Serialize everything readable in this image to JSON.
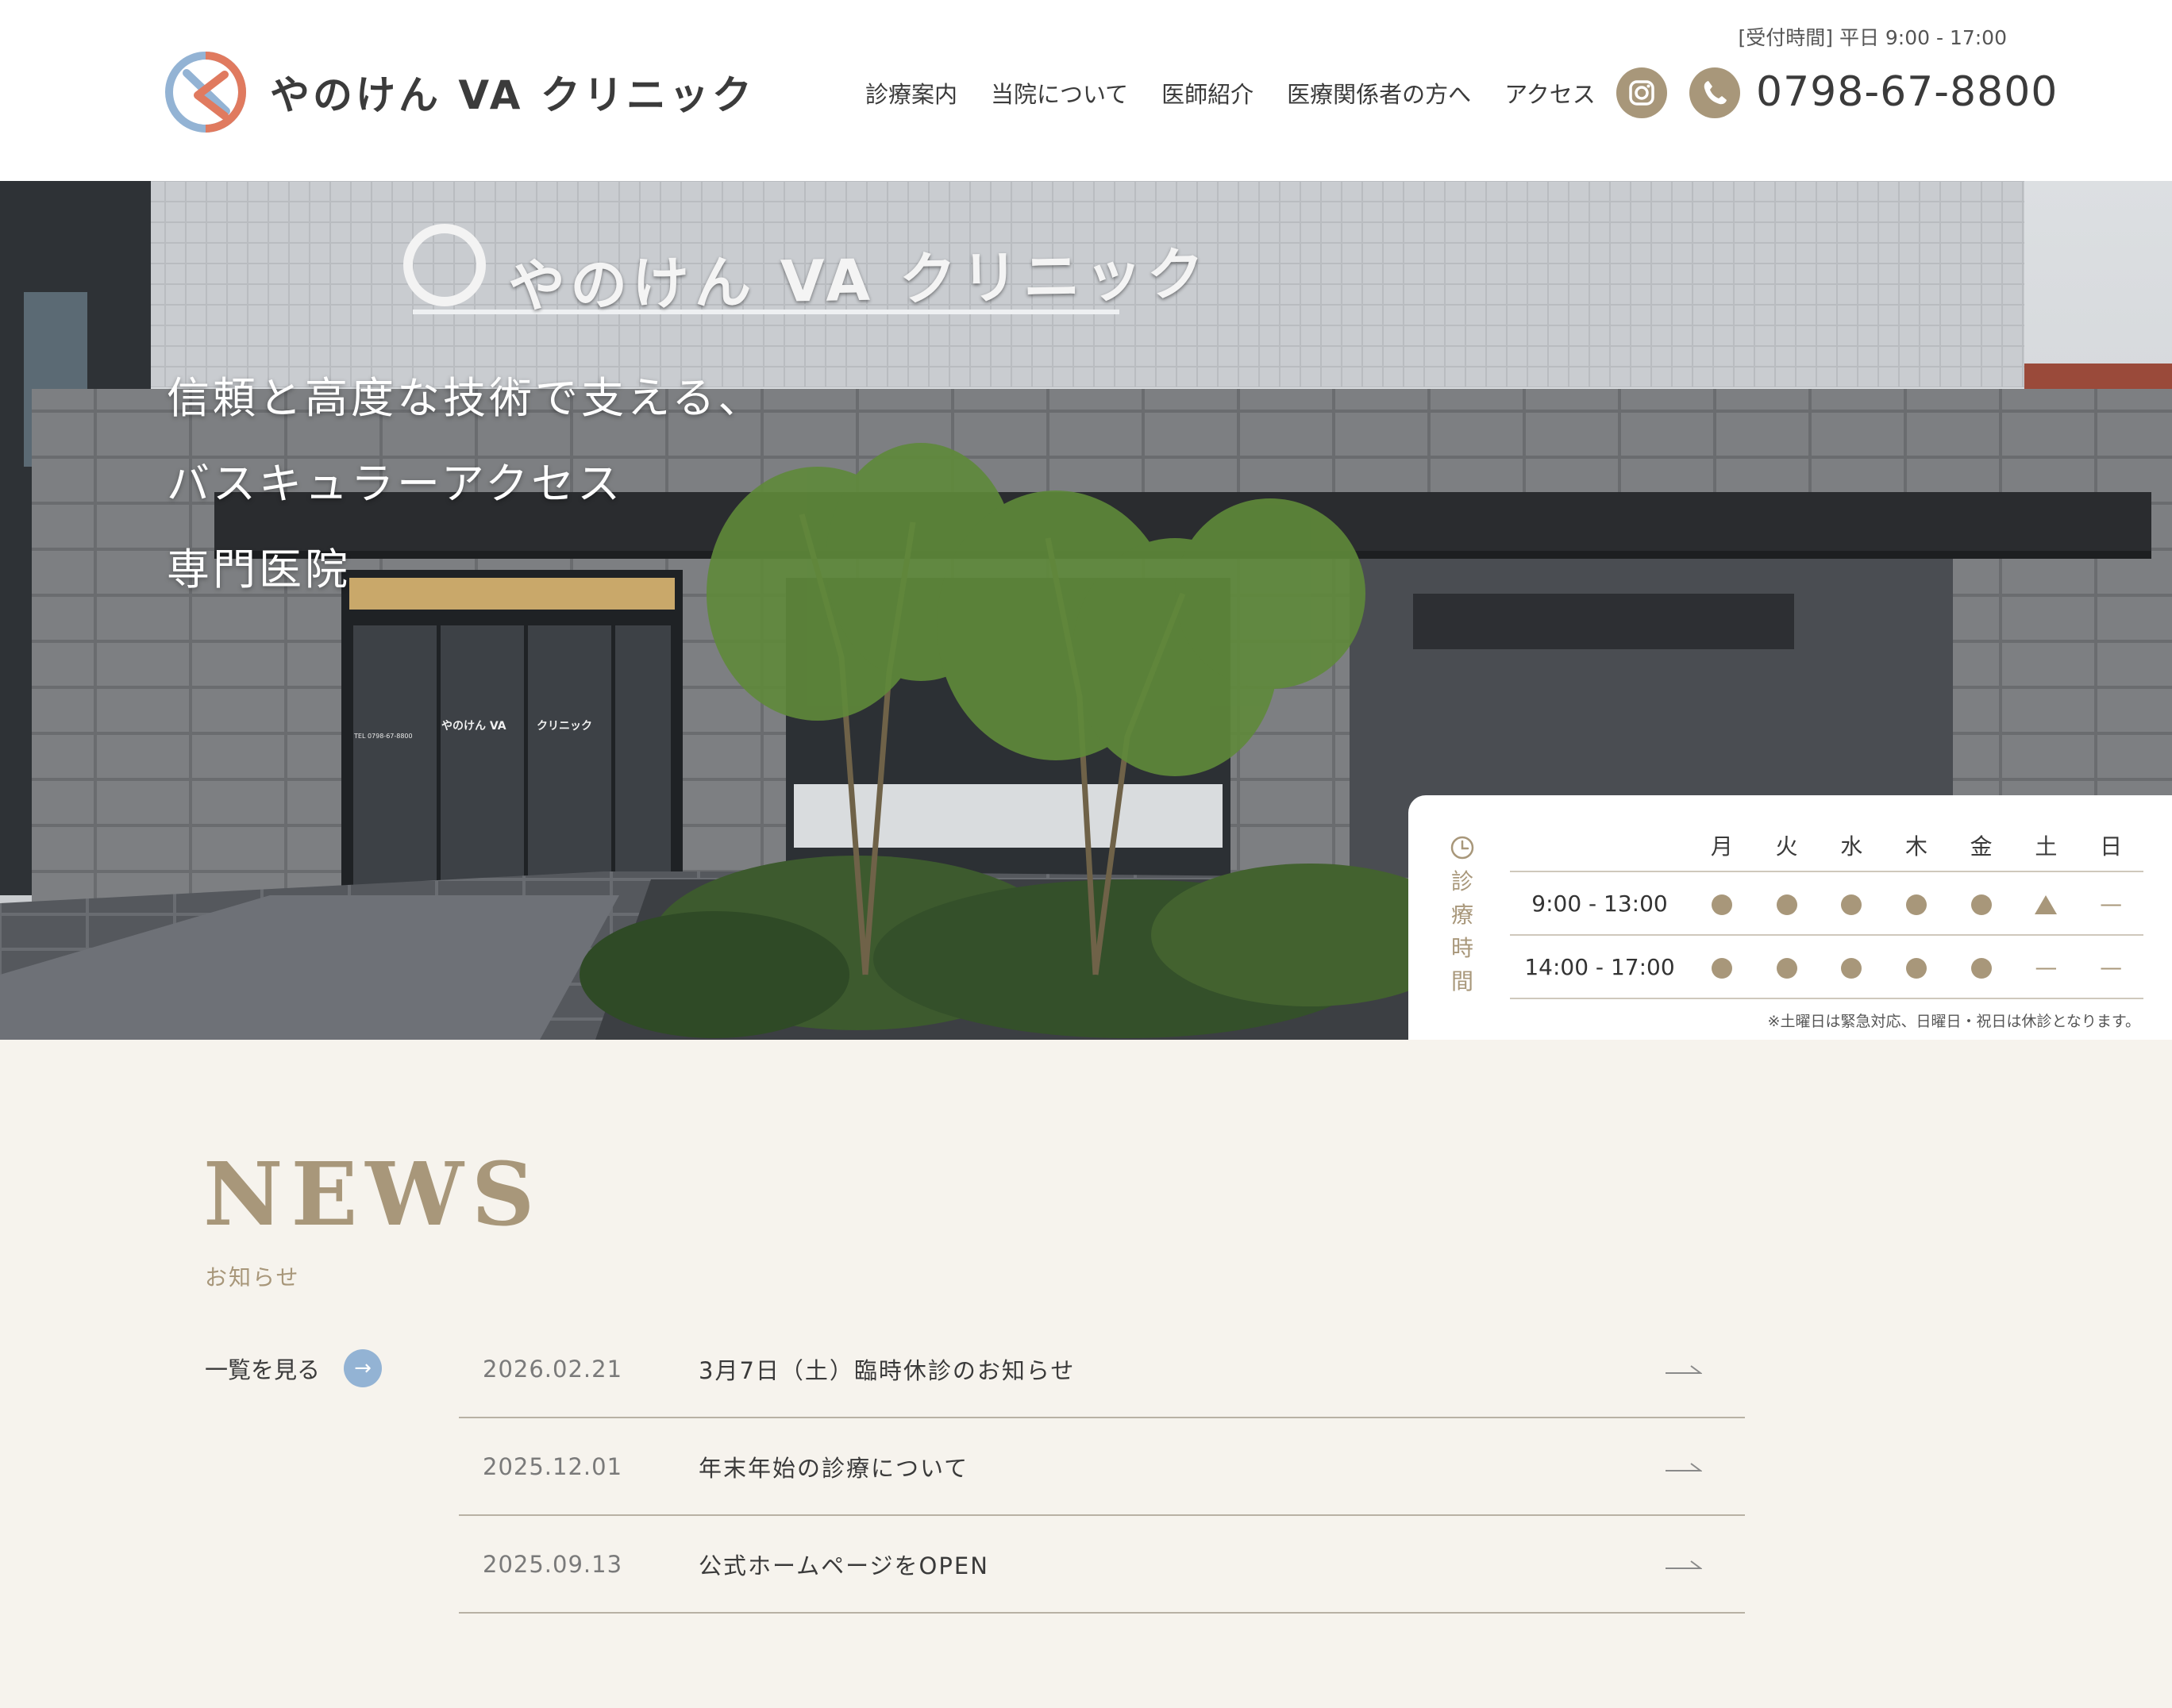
{
  "header": {
    "clinic_name": "やのけん VA クリニック",
    "hours_note": "[受付時間] 平日 9:00 - 17:00",
    "nav": [
      "診療案内",
      "当院について",
      "医師紹介",
      "医療関係者の方へ",
      "アクセス"
    ],
    "phone": "0798-67-8800",
    "icons": [
      "instagram-icon",
      "phone-icon"
    ]
  },
  "hero": {
    "lines": [
      "信頼と高度な技術で支える、",
      "バスキュラーアクセス",
      "専門医院"
    ],
    "building_sign": "やのけん VA クリニック",
    "door_sign_left": "やのけん VA",
    "door_sign_right": "クリニック",
    "door_tel": "TEL 0798-67-8800"
  },
  "schedule": {
    "label": [
      "診",
      "療",
      "時",
      "間"
    ],
    "days": [
      "月",
      "火",
      "水",
      "木",
      "金",
      "土",
      "日"
    ],
    "rows": [
      {
        "time": "9:00 - 13:00",
        "marks": [
          "●",
          "●",
          "●",
          "●",
          "●",
          "▲",
          "—"
        ]
      },
      {
        "time": "14:00 - 17:00",
        "marks": [
          "●",
          "●",
          "●",
          "●",
          "●",
          "—",
          "—"
        ]
      }
    ],
    "note": "※土曜日は緊急対応、日曜日・祝日は休診となります。"
  },
  "news": {
    "title": "NEWS",
    "subtitle": "お知らせ",
    "view_all": "一覧を見る",
    "items": [
      {
        "date": "2026.02.21",
        "text": "3月7日（土）臨時休診のお知らせ"
      },
      {
        "date": "2025.12.01",
        "text": "年末年始の診療について"
      },
      {
        "date": "2025.09.13",
        "text": "公式ホームページをOPEN"
      }
    ]
  },
  "colors": {
    "accent": "#a8977a",
    "blue": "#93b3d4",
    "logo_orange": "#e07a5f",
    "bg": "#f6f3ed"
  }
}
